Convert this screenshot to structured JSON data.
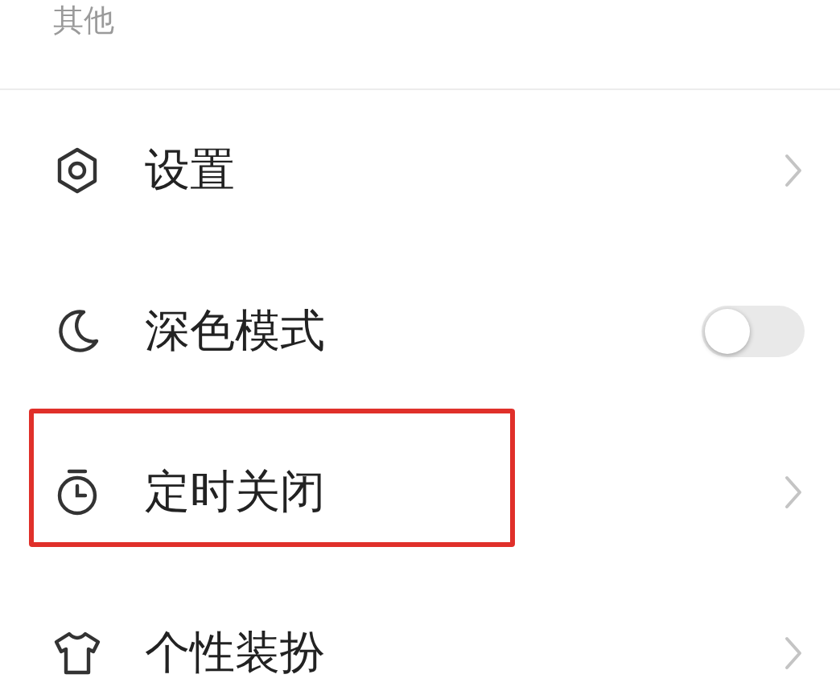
{
  "section_title": "其他",
  "items": [
    {
      "kind": "link",
      "label": "设置",
      "highlighted": false
    },
    {
      "kind": "toggle",
      "label": "深色模式",
      "on": false,
      "highlighted": false
    },
    {
      "kind": "link",
      "label": "定时关闭",
      "highlighted": true
    },
    {
      "kind": "link",
      "label": "个性装扮",
      "highlighted": false
    }
  ]
}
